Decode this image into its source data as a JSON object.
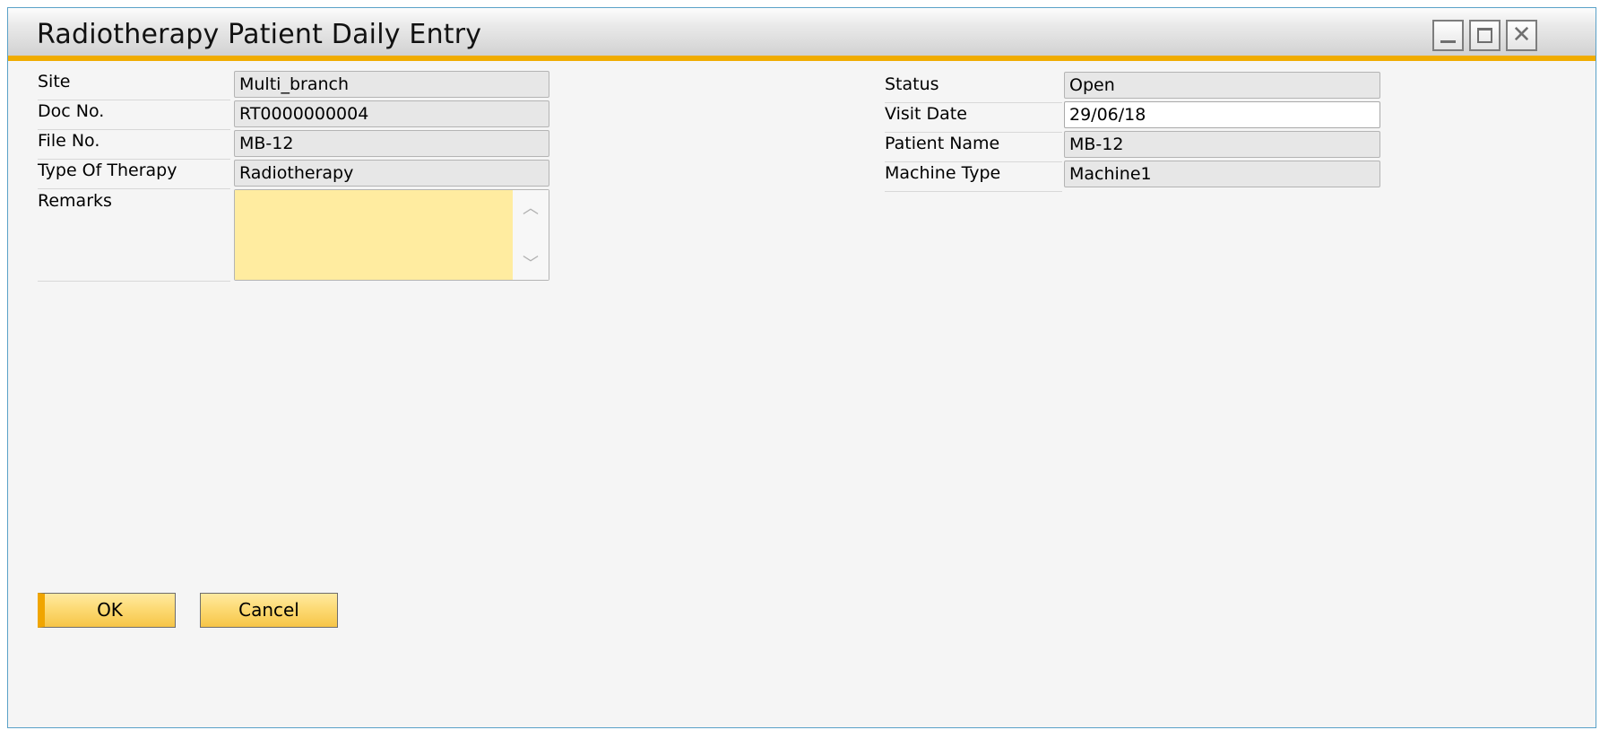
{
  "window": {
    "title": "Radiotherapy Patient Daily Entry",
    "controls": {
      "minimize": "minimize-icon",
      "maximize": "maximize-icon",
      "close_symbol": "✕"
    },
    "accent_color": "#f0ac00"
  },
  "left_fields": {
    "site": {
      "label": "Site",
      "value": "Multi_branch"
    },
    "doc_no": {
      "label": "Doc No.",
      "value": "RT0000000004"
    },
    "file_no": {
      "label": "File No.",
      "value": "MB-12"
    },
    "type_of_therapy": {
      "label": "Type Of Therapy",
      "value": "Radiotherapy"
    },
    "remarks": {
      "label": "Remarks",
      "value": ""
    }
  },
  "right_fields": {
    "status": {
      "label": "Status",
      "value": "Open"
    },
    "visit_date": {
      "label": "Visit Date",
      "value": "29/06/18"
    },
    "patient_name": {
      "label": "Patient Name",
      "value": "MB-12"
    },
    "machine_type": {
      "label": "Machine Type",
      "value": "Machine1"
    }
  },
  "buttons": {
    "ok": "OK",
    "cancel": "Cancel"
  },
  "scroll_arrows": {
    "up": "︿",
    "down": "﹀"
  }
}
